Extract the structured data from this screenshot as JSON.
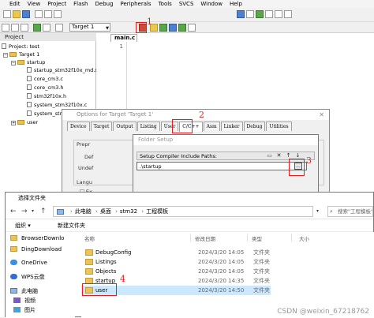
{
  "menu": [
    "Edit",
    "View",
    "Project",
    "Flash",
    "Debug",
    "Peripherals",
    "Tools",
    "SVCS",
    "Window",
    "Help"
  ],
  "toolbar": {
    "target": "Target 1"
  },
  "project": {
    "title": "Project",
    "root": "Project: test",
    "target": "Target 1",
    "group1": "startup",
    "files": [
      "startup_stm32f10x_md.s",
      "core_cm3.c",
      "core_cm3.h",
      "stm32f10x.h",
      "system_stm32f10x.c",
      "system_stm..."
    ],
    "group2": "user"
  },
  "editor": {
    "tab": "main.c",
    "line": "1"
  },
  "options": {
    "title": "Options for Target 'Target 1'",
    "close": "✕",
    "tabs": [
      "Device",
      "Target",
      "Output",
      "Listing",
      "User",
      "C/C++",
      "Asm",
      "Linker",
      "Debug",
      "Utilities"
    ],
    "labels": [
      "Prepr",
      "Def",
      "Undef",
      "Langu"
    ],
    "checkbox_label": "Ex"
  },
  "folder_setup": {
    "title": "Folder Setup",
    "subtitle": "Setup Compiler Include Paths:",
    "path": ".\\startup",
    "browse": "..."
  },
  "select_folder": {
    "title": "选择文件夹",
    "breadcrumb": [
      "此电脑",
      "桌面",
      "stm32",
      "工程模板"
    ],
    "search_placeholder": "搜索\"工程模板\"",
    "organize": "组织 ▾",
    "new_folder": "新建文件夹",
    "nav": [
      "BrowserDownlo",
      "DingDownload",
      "OneDrive",
      "WPS云盘",
      "此电脑",
      "视频",
      "图片"
    ],
    "columns": {
      "name": "名称",
      "date": "修改日期",
      "type": "类型",
      "size": "大小"
    },
    "rows": [
      {
        "name": "DebugConfig",
        "date": "2024/3/20 14:05",
        "type": "文件夹"
      },
      {
        "name": "Listings",
        "date": "2024/3/20 14:05",
        "type": "文件夹"
      },
      {
        "name": "Objects",
        "date": "2024/3/20 14:05",
        "type": "文件夹"
      },
      {
        "name": "startup",
        "date": "2024/3/20 14:35",
        "type": "文件夹"
      },
      {
        "name": "user",
        "date": "2024/3/20 14:50",
        "type": "文件夹"
      }
    ]
  },
  "annotations": {
    "n1": "1",
    "n2": "2",
    "n3": "3",
    "n4": "4"
  },
  "watermark": "CSDN @weixin_67218762"
}
